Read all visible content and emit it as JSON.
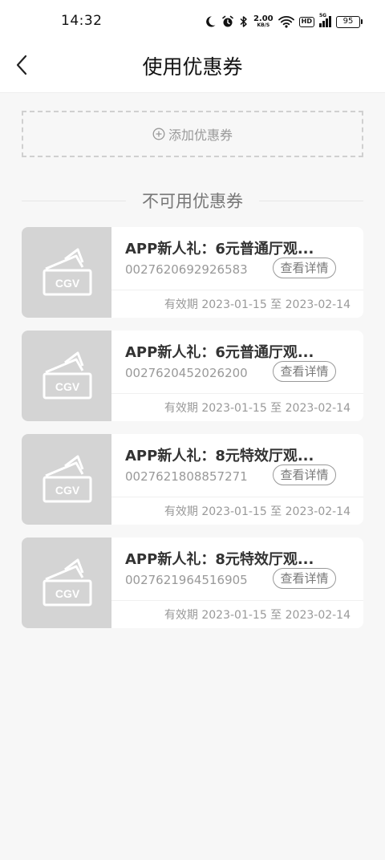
{
  "status_bar": {
    "time": "14:32",
    "speed_value": "2.00",
    "speed_unit": "KB/S",
    "hd_label": "HD",
    "signal_label": "5G",
    "battery": "95",
    "icons": [
      "moon-icon",
      "alarm-icon",
      "bluetooth-icon",
      "wifi-icon",
      "signal-icon",
      "battery-icon"
    ]
  },
  "nav": {
    "title": "使用优惠券",
    "back_icon": "chevron-left-icon"
  },
  "add_coupon": {
    "label": "添加优惠券",
    "icon": "plus-circle-icon"
  },
  "section": {
    "title": "不可用优惠券"
  },
  "coupons": [
    {
      "name": "APP新人礼：6元普通厅观...",
      "code": "0027620692926583",
      "detail_label": "查看详情",
      "validity": "有效期 2023-01-15 至 2023-02-14"
    },
    {
      "name": "APP新人礼：6元普通厅观...",
      "code": "0027620452026200",
      "detail_label": "查看详情",
      "validity": "有效期 2023-01-15 至 2023-02-14"
    },
    {
      "name": "APP新人礼：8元特效厅观...",
      "code": "0027621808857271",
      "detail_label": "查看详情",
      "validity": "有效期 2023-01-15 至 2023-02-14"
    },
    {
      "name": "APP新人礼：8元特效厅观...",
      "code": "0027621964516905",
      "detail_label": "查看详情",
      "validity": "有效期 2023-01-15 至 2023-02-14"
    }
  ]
}
